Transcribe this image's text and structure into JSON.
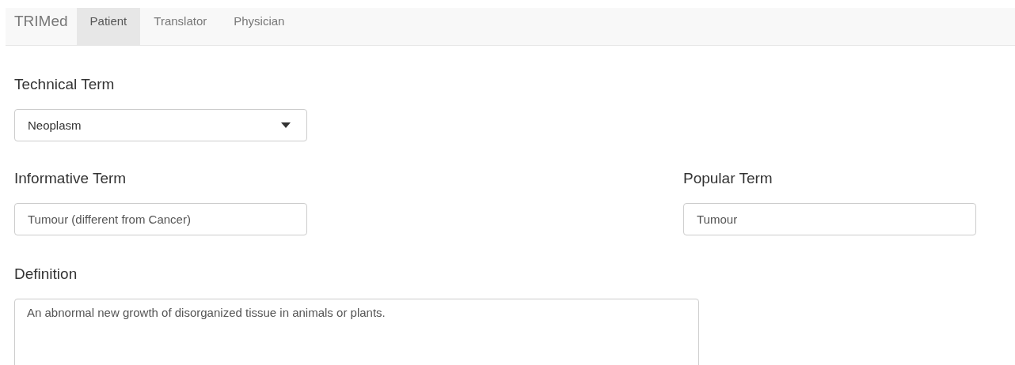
{
  "navbar": {
    "brand": "TRIMed",
    "tabs": [
      {
        "label": "Patient",
        "selected": true
      },
      {
        "label": "Translator",
        "selected": false
      },
      {
        "label": "Physician",
        "selected": false
      }
    ]
  },
  "technical_term": {
    "label": "Technical Term",
    "value": "Neoplasm"
  },
  "informative_term": {
    "label": "Informative Term",
    "value": "Tumour (different from Cancer)"
  },
  "popular_term": {
    "label": "Popular Term",
    "value": "Tumour"
  },
  "definition": {
    "label": "Definition",
    "value": "An abnormal new growth of disorganized tissue in animals or plants."
  }
}
